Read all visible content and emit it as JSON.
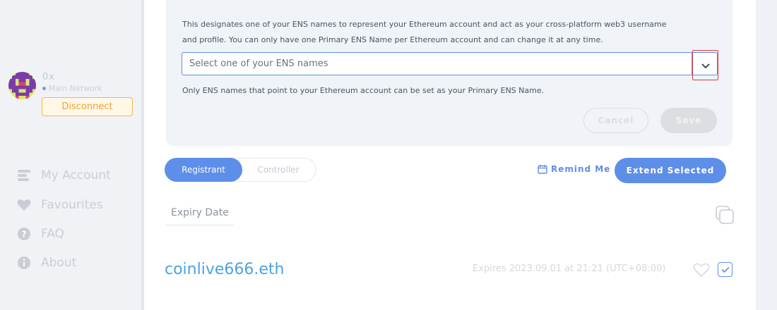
{
  "sidebar": {
    "account": {
      "address": "0x",
      "network": "Main Network"
    },
    "disconnect_label": "Disconnect",
    "nav": [
      {
        "label": "My Account",
        "icon": "account-icon"
      },
      {
        "label": "Favourites",
        "icon": "heart-icon"
      },
      {
        "label": "FAQ",
        "icon": "question-icon"
      },
      {
        "label": "About",
        "icon": "info-icon"
      }
    ]
  },
  "primary_ens": {
    "description_line1": "This designates one of your ENS names to represent your Ethereum account and act as your cross-platform web3 username",
    "description_line2": "and profile. You can only have one Primary ENS Name per Ethereum account and can change it at any time.",
    "select_placeholder": "Select one of your ENS names",
    "note": "Only ENS names that point to your Ethereum account can be set as your Primary ENS Name.",
    "cancel_label": "Cancel",
    "save_label": "Save"
  },
  "toolbar": {
    "tabs": [
      {
        "label": "Registrant",
        "active": true
      },
      {
        "label": "Controller",
        "active": false
      }
    ],
    "remind_label": "Remind Me",
    "extend_label": "Extend Selected",
    "sort_label": "Expiry Date"
  },
  "domains": [
    {
      "name": "coinlive666.eth",
      "expires": "Expires 2023.09.01 at 21:21 (UTC+08:00)"
    }
  ],
  "colors": {
    "accent": "#5d8ee8",
    "link": "#4aa3e0",
    "warning": "#f0a430",
    "highlight": "#e03a3a"
  }
}
